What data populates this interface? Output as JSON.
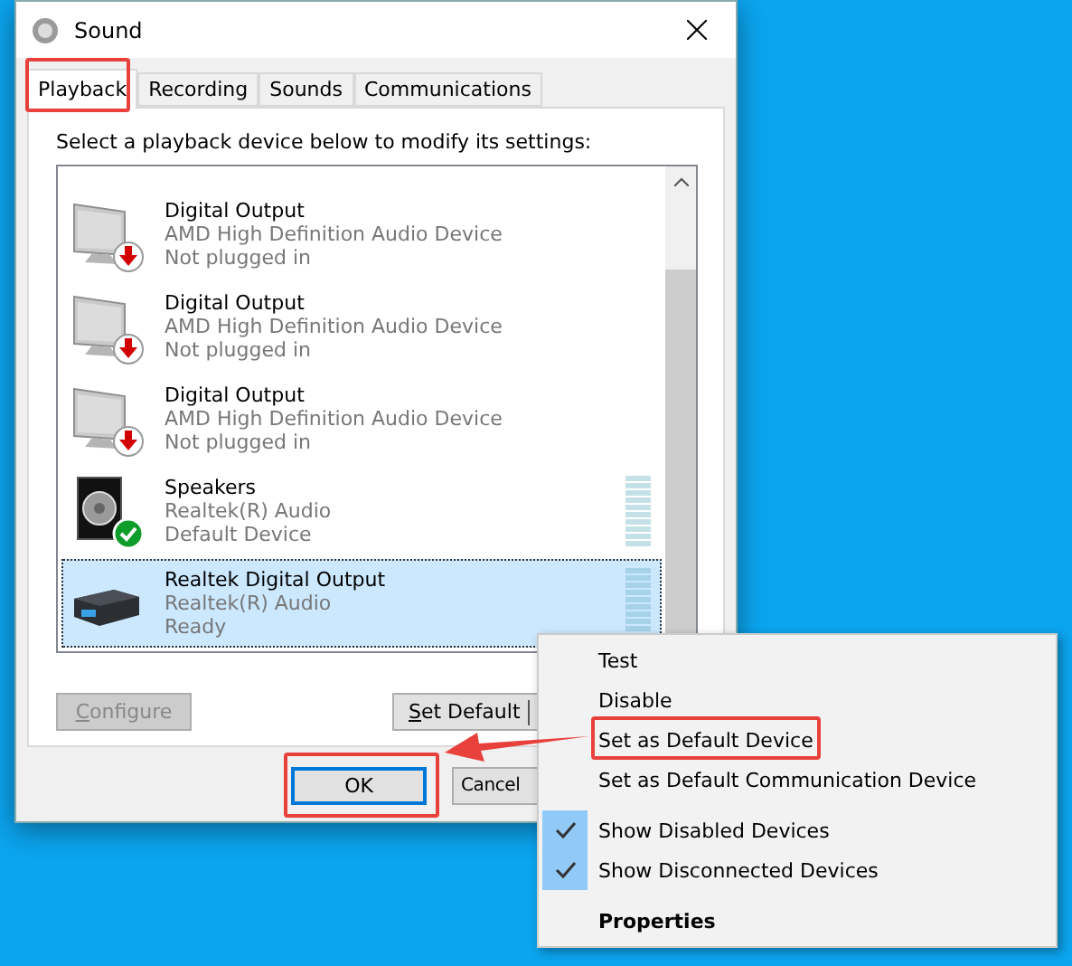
{
  "window": {
    "title": "Sound"
  },
  "tabs": [
    {
      "label": "Playback",
      "selected": true
    },
    {
      "label": "Recording",
      "selected": false
    },
    {
      "label": "Sounds",
      "selected": false
    },
    {
      "label": "Communications",
      "selected": false
    }
  ],
  "instruction": "Select a playback device below to modify its settings:",
  "devices": [
    {
      "name": "Digital Output",
      "driver": "AMD High Definition Audio Device",
      "status": "Not plugged in",
      "kind": "monitor",
      "unplugged": true,
      "default": false,
      "meter": false,
      "selected": false
    },
    {
      "name": "Digital Output",
      "driver": "AMD High Definition Audio Device",
      "status": "Not plugged in",
      "kind": "monitor",
      "unplugged": true,
      "default": false,
      "meter": false,
      "selected": false
    },
    {
      "name": "Digital Output",
      "driver": "AMD High Definition Audio Device",
      "status": "Not plugged in",
      "kind": "monitor",
      "unplugged": true,
      "default": false,
      "meter": false,
      "selected": false
    },
    {
      "name": "Speakers",
      "driver": "Realtek(R) Audio",
      "status": "Default Device",
      "kind": "speaker",
      "unplugged": false,
      "default": true,
      "meter": true,
      "selected": false
    },
    {
      "name": "Realtek Digital Output",
      "driver": "Realtek(R) Audio",
      "status": "Ready",
      "kind": "receiver",
      "unplugged": false,
      "default": false,
      "meter": true,
      "selected": true
    }
  ],
  "configure": {
    "label": "Configure",
    "disabled": true
  },
  "set_default": {
    "label": "Set Default"
  },
  "ok": {
    "label": "OK",
    "focused": true
  },
  "cancel": {
    "label": "Cancel",
    "focused": false
  },
  "context_menu": [
    {
      "kind": "item",
      "label": "Test",
      "checked": false,
      "bold": false
    },
    {
      "kind": "item",
      "label": "Disable",
      "checked": false,
      "bold": false
    },
    {
      "kind": "item",
      "label": "Set as Default Device",
      "checked": false,
      "bold": false
    },
    {
      "kind": "item",
      "label": "Set as Default Communication Device",
      "checked": false,
      "bold": false
    },
    {
      "kind": "separator"
    },
    {
      "kind": "item",
      "label": "Show Disabled Devices",
      "checked": true,
      "bold": false
    },
    {
      "kind": "item",
      "label": "Show Disconnected Devices",
      "checked": true,
      "bold": false
    },
    {
      "kind": "separator"
    },
    {
      "kind": "item",
      "label": "Properties",
      "checked": false,
      "bold": true
    }
  ]
}
